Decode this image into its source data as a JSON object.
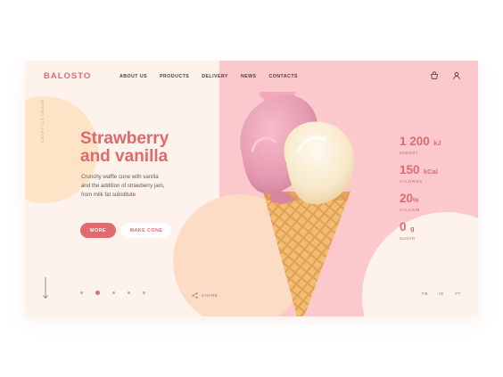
{
  "brand": {
    "logo": "BALOSTO"
  },
  "nav": {
    "items": [
      "ABOUT US",
      "PRODUCTS",
      "DELIVERY",
      "NEWS",
      "CONTACTS"
    ]
  },
  "header_icons": [
    "cart-icon",
    "user-icon"
  ],
  "side_label": "CRAFT ICE CREAM",
  "hero": {
    "title_line1": "Strawberry",
    "title_line2": "and vanilla",
    "desc_line1": "Crunchy waffle cone with vanilla",
    "desc_line2": "and the addition of strawberry jam,",
    "desc_line3": "from milk fat substitute"
  },
  "buttons": {
    "more": "MORE",
    "make_cone": "MAKE CONE"
  },
  "slider": {
    "count": 5,
    "active_index": 1
  },
  "share_label": "SHARE",
  "stats": [
    {
      "value": "1 200",
      "unit": "kJ",
      "label": "ENERGY"
    },
    {
      "value": "150",
      "unit": "kCal",
      "label": "CALORIES"
    },
    {
      "value": "20",
      "unit": "%",
      "label": "CALCIUM"
    },
    {
      "value": "0",
      "unit": "g",
      "label": "SUGAR"
    }
  ],
  "socials": [
    "FB",
    "IG",
    "YT"
  ],
  "colors": {
    "accent": "#e06b6e",
    "pink_panel": "#fbc9cc",
    "background": "#fdf2ec",
    "peach": "#fddcc5"
  }
}
